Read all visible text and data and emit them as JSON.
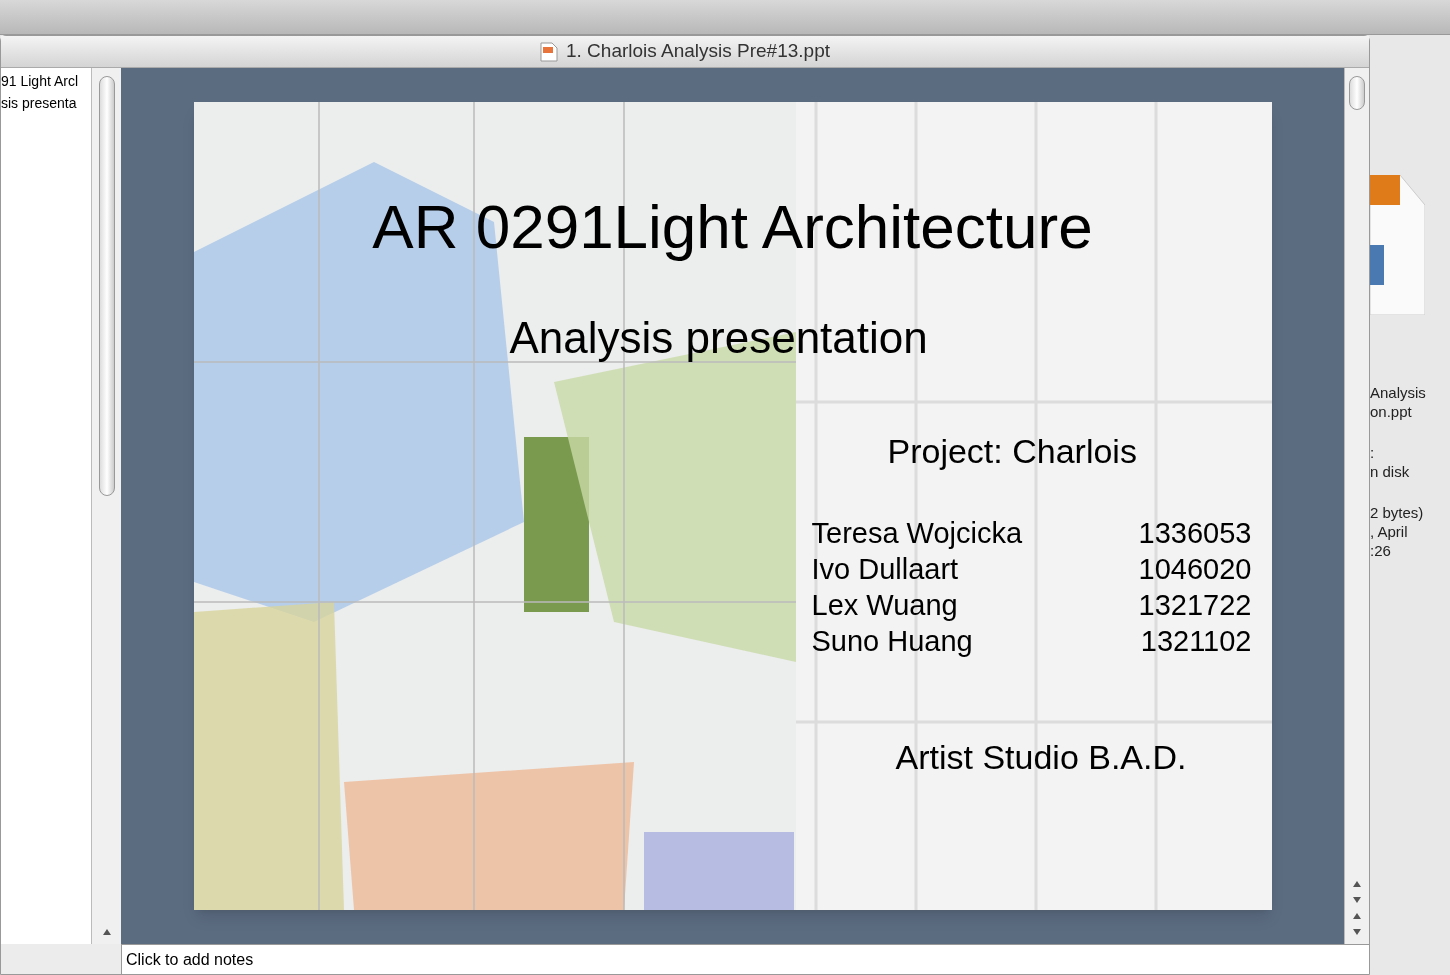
{
  "window": {
    "title": "1. Charlois Analysis Pre#13.ppt"
  },
  "outline": {
    "lines": [
      "91 Light Arcl",
      "sis presenta"
    ]
  },
  "slide": {
    "title": "AR 0291Light Architecture",
    "subtitle": "Analysis presentation",
    "project": "Project: Charlois",
    "members": [
      {
        "name": "Teresa Wojcicka",
        "number": "1336053"
      },
      {
        "name": "Ivo Dullaart",
        "number": "1046020"
      },
      {
        "name": "Lex Wuang",
        "number": "1321722"
      },
      {
        "name": "Suno Huang",
        "number": "1321102"
      }
    ],
    "studio": "Artist Studio B.A.D."
  },
  "notes": {
    "placeholder": "Click to add notes"
  },
  "file_info": {
    "lines": [
      "Analysis",
      "on.ppt",
      ":",
      "n disk",
      "2 bytes)",
      ", April",
      ":26"
    ]
  }
}
